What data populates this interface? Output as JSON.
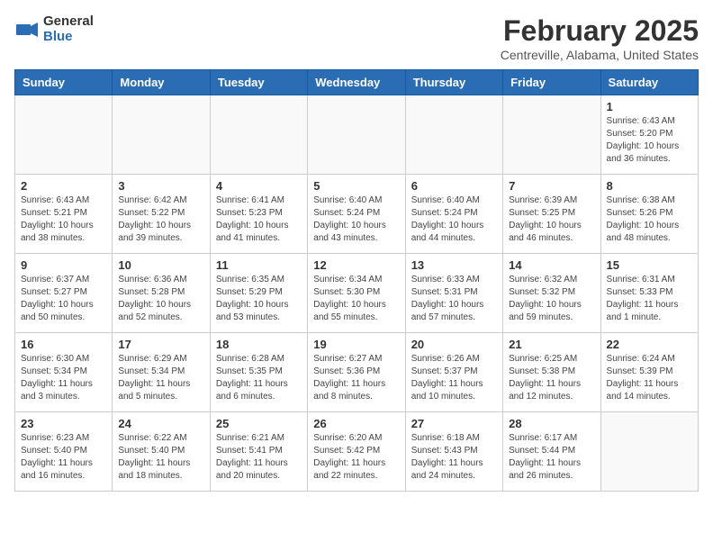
{
  "header": {
    "logo_general": "General",
    "logo_blue": "Blue",
    "month_title": "February 2025",
    "location": "Centreville, Alabama, United States"
  },
  "weekdays": [
    "Sunday",
    "Monday",
    "Tuesday",
    "Wednesday",
    "Thursday",
    "Friday",
    "Saturday"
  ],
  "weeks": [
    [
      {
        "day": "",
        "info": ""
      },
      {
        "day": "",
        "info": ""
      },
      {
        "day": "",
        "info": ""
      },
      {
        "day": "",
        "info": ""
      },
      {
        "day": "",
        "info": ""
      },
      {
        "day": "",
        "info": ""
      },
      {
        "day": "1",
        "info": "Sunrise: 6:43 AM\nSunset: 5:20 PM\nDaylight: 10 hours and 36 minutes."
      }
    ],
    [
      {
        "day": "2",
        "info": "Sunrise: 6:43 AM\nSunset: 5:21 PM\nDaylight: 10 hours and 38 minutes."
      },
      {
        "day": "3",
        "info": "Sunrise: 6:42 AM\nSunset: 5:22 PM\nDaylight: 10 hours and 39 minutes."
      },
      {
        "day": "4",
        "info": "Sunrise: 6:41 AM\nSunset: 5:23 PM\nDaylight: 10 hours and 41 minutes."
      },
      {
        "day": "5",
        "info": "Sunrise: 6:40 AM\nSunset: 5:24 PM\nDaylight: 10 hours and 43 minutes."
      },
      {
        "day": "6",
        "info": "Sunrise: 6:40 AM\nSunset: 5:24 PM\nDaylight: 10 hours and 44 minutes."
      },
      {
        "day": "7",
        "info": "Sunrise: 6:39 AM\nSunset: 5:25 PM\nDaylight: 10 hours and 46 minutes."
      },
      {
        "day": "8",
        "info": "Sunrise: 6:38 AM\nSunset: 5:26 PM\nDaylight: 10 hours and 48 minutes."
      }
    ],
    [
      {
        "day": "9",
        "info": "Sunrise: 6:37 AM\nSunset: 5:27 PM\nDaylight: 10 hours and 50 minutes."
      },
      {
        "day": "10",
        "info": "Sunrise: 6:36 AM\nSunset: 5:28 PM\nDaylight: 10 hours and 52 minutes."
      },
      {
        "day": "11",
        "info": "Sunrise: 6:35 AM\nSunset: 5:29 PM\nDaylight: 10 hours and 53 minutes."
      },
      {
        "day": "12",
        "info": "Sunrise: 6:34 AM\nSunset: 5:30 PM\nDaylight: 10 hours and 55 minutes."
      },
      {
        "day": "13",
        "info": "Sunrise: 6:33 AM\nSunset: 5:31 PM\nDaylight: 10 hours and 57 minutes."
      },
      {
        "day": "14",
        "info": "Sunrise: 6:32 AM\nSunset: 5:32 PM\nDaylight: 10 hours and 59 minutes."
      },
      {
        "day": "15",
        "info": "Sunrise: 6:31 AM\nSunset: 5:33 PM\nDaylight: 11 hours and 1 minute."
      }
    ],
    [
      {
        "day": "16",
        "info": "Sunrise: 6:30 AM\nSunset: 5:34 PM\nDaylight: 11 hours and 3 minutes."
      },
      {
        "day": "17",
        "info": "Sunrise: 6:29 AM\nSunset: 5:34 PM\nDaylight: 11 hours and 5 minutes."
      },
      {
        "day": "18",
        "info": "Sunrise: 6:28 AM\nSunset: 5:35 PM\nDaylight: 11 hours and 6 minutes."
      },
      {
        "day": "19",
        "info": "Sunrise: 6:27 AM\nSunset: 5:36 PM\nDaylight: 11 hours and 8 minutes."
      },
      {
        "day": "20",
        "info": "Sunrise: 6:26 AM\nSunset: 5:37 PM\nDaylight: 11 hours and 10 minutes."
      },
      {
        "day": "21",
        "info": "Sunrise: 6:25 AM\nSunset: 5:38 PM\nDaylight: 11 hours and 12 minutes."
      },
      {
        "day": "22",
        "info": "Sunrise: 6:24 AM\nSunset: 5:39 PM\nDaylight: 11 hours and 14 minutes."
      }
    ],
    [
      {
        "day": "23",
        "info": "Sunrise: 6:23 AM\nSunset: 5:40 PM\nDaylight: 11 hours and 16 minutes."
      },
      {
        "day": "24",
        "info": "Sunrise: 6:22 AM\nSunset: 5:40 PM\nDaylight: 11 hours and 18 minutes."
      },
      {
        "day": "25",
        "info": "Sunrise: 6:21 AM\nSunset: 5:41 PM\nDaylight: 11 hours and 20 minutes."
      },
      {
        "day": "26",
        "info": "Sunrise: 6:20 AM\nSunset: 5:42 PM\nDaylight: 11 hours and 22 minutes."
      },
      {
        "day": "27",
        "info": "Sunrise: 6:18 AM\nSunset: 5:43 PM\nDaylight: 11 hours and 24 minutes."
      },
      {
        "day": "28",
        "info": "Sunrise: 6:17 AM\nSunset: 5:44 PM\nDaylight: 11 hours and 26 minutes."
      },
      {
        "day": "",
        "info": ""
      }
    ]
  ]
}
